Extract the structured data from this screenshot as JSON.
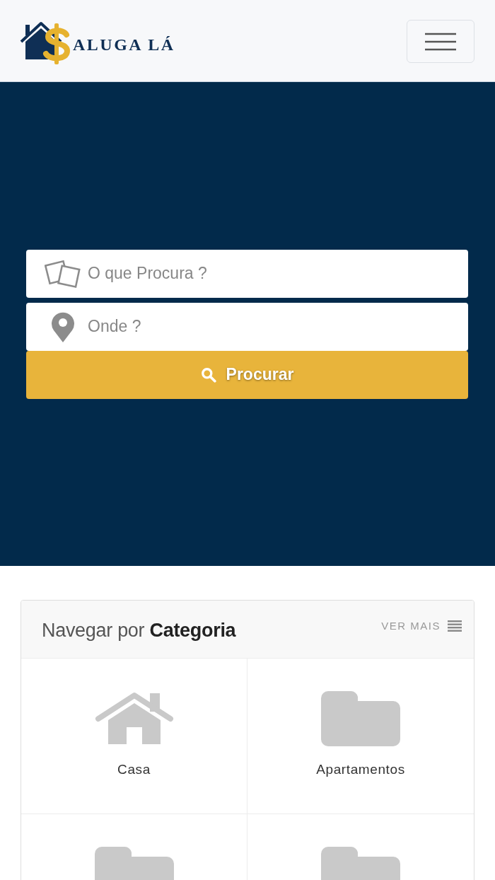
{
  "header": {
    "logo_text": "ALUGA LÁ"
  },
  "search": {
    "fields": [
      {
        "kind": "category",
        "placeholder": "O que Procura ?"
      },
      {
        "kind": "location",
        "placeholder": "Onde ?"
      }
    ],
    "button": "Procurar"
  },
  "categories_panel": {
    "title": "Navegar por **Categoria**",
    "more_link": "VER MAIS",
    "items": [
      {
        "kind": "house",
        "label": "Casa"
      },
      {
        "kind": "folder",
        "label": "Apartamentos"
      },
      {
        "kind": "folder"
      },
      {
        "kind": "folder"
      }
    ]
  }
}
